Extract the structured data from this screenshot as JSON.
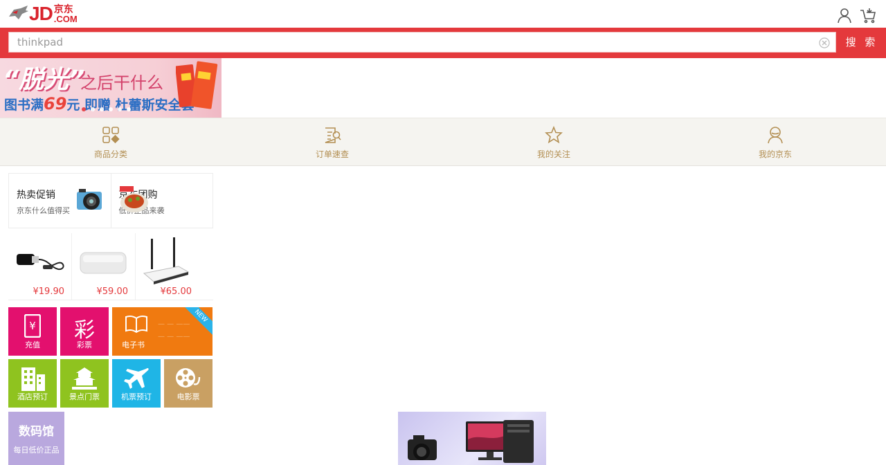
{
  "app": {
    "logo_text": "JD",
    "logo_cn": "京东",
    "logo_com": ".COM"
  },
  "header": {
    "icons": [
      "user-icon",
      "cart-icon"
    ]
  },
  "search": {
    "value": "thinkpad",
    "button_label": "搜 索"
  },
  "banner": {
    "headline": "“脱光”",
    "headline_tail": "之后干什么",
    "offer_prefix": "图书满",
    "offer_amount": "69",
    "offer_mid": "元 即赠",
    "offer_gift": "杜蕾斯安全套",
    "slides": 6,
    "active_slide": 0
  },
  "nav": {
    "items": [
      {
        "label": "商品分类",
        "icon": "grid-icon"
      },
      {
        "label": "订单速查",
        "icon": "order-search-icon"
      },
      {
        "label": "我的关注",
        "icon": "star-icon"
      },
      {
        "label": "我的京东",
        "icon": "user-icon"
      }
    ]
  },
  "promos": [
    {
      "title": "热卖促销",
      "subtitle": "京东什么值得买",
      "icon": "camera-image"
    },
    {
      "title": "京东团购",
      "subtitle": "低价正品来袭",
      "icon": "food-image"
    }
  ],
  "products": [
    {
      "price": "¥19.90",
      "icon": "usb-adapter-image"
    },
    {
      "price": "¥59.00",
      "icon": "power-bank-image"
    },
    {
      "price": "¥65.00",
      "icon": "router-image"
    }
  ],
  "tiles": {
    "recharge": "充值",
    "lottery": "彩票",
    "lottery_big": "彩",
    "ebook": "电子书",
    "ebook_new": "NEW",
    "hotel": "酒店预订",
    "scenic": "景点门票",
    "flight": "机票预订",
    "movie": "电影票",
    "digital_title": "数码馆",
    "digital_sub": "每日低价正品"
  },
  "colors": {
    "brand_red": "#e4393c",
    "nav_text": "#b38f53",
    "magenta": "#e3106e",
    "orange": "#f07a10",
    "green": "#8fc31f",
    "cyan": "#1fb5e6",
    "tan": "#c9a063",
    "lavender": "#b9a8de"
  }
}
